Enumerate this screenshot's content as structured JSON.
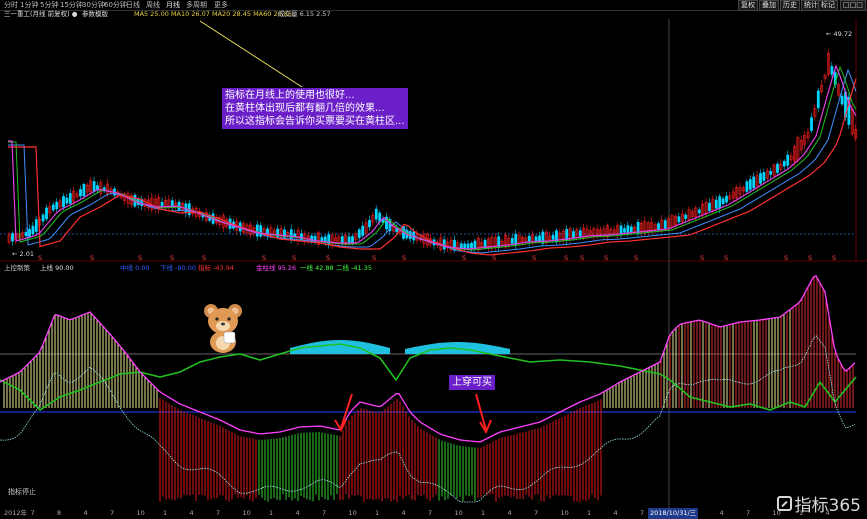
{
  "toolbar": {
    "left_items": [
      "分时",
      "1分钟",
      "5分钟",
      "15分钟",
      "30分钟",
      "60分钟",
      "日线",
      "周线",
      "月线",
      "多周期",
      "更多"
    ],
    "active": "月线",
    "right_buttons": [
      "复权",
      "叠加",
      "历史",
      "统计",
      "标记",
      "□□□"
    ]
  },
  "info_row": {
    "stock_name": "三一重工(月线 前复权) ●",
    "note": "参数模版",
    "ma_text": "MA5 25.00  MA10 26.07  MA20 28.45  MA60 20.85",
    "vol_text": "成交量 6.15  2.57"
  },
  "price_labels": {
    "high": "49.72",
    "low": "2.01"
  },
  "indicator_row": {
    "name": "上控制策",
    "values": [
      "上线 90.00",
      "中线 0.00",
      "下线 -90.00",
      "指标 -43.94",
      "金柱线 95.26",
      "一线 42.88",
      "二线 -41.35"
    ]
  },
  "annotations": {
    "main_note": [
      "指标在月线上的使用也很好...",
      "在黄柱体出现后都有翻几倍的效果...",
      "所以这指标会告诉你买票要买在黄柱区..."
    ],
    "cross_note": "上穿可买"
  },
  "footer": {
    "years": [
      "2012年",
      "7",
      "8",
      "4",
      "7",
      "10",
      "1",
      "4",
      "7",
      "10",
      "1",
      "4",
      "7",
      "10",
      "1",
      "4",
      "7",
      "10",
      "1",
      "4",
      "7",
      "10",
      "1",
      "4",
      "7",
      "10",
      "1",
      "4",
      "7",
      "10",
      "1",
      "4"
    ],
    "highlight_date": "2018/10/31/三",
    "panel_label": "指标停止"
  },
  "watermark": "指标365",
  "colors": {
    "up": "#ff2020",
    "down": "#00d4ff",
    "ma1": "#ff3030",
    "ma2": "#e040e0",
    "ma3": "#20c020",
    "ma4": "#4090ff",
    "annot_bg": "#6a1fc8",
    "grid_blue": "#2040ff"
  }
}
